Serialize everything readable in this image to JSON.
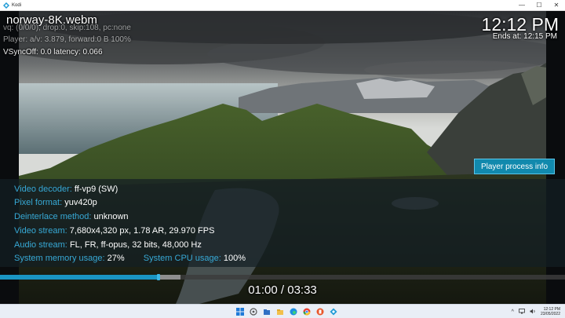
{
  "window": {
    "app_title": "Kodi",
    "controls": {
      "minimize": "—",
      "maximize": "☐",
      "close": "✕"
    }
  },
  "osd": {
    "file_title": "norway-8K.webm",
    "debug_line1": "vq:                               (0/0/0), drop:0, skip:108, pc:none",
    "debug_line2": "Player: a/v: 3.879, forward:0 B 100%",
    "debug_line3": "VSyncOff: 0.0 latency: 0.066",
    "clock": "12:12 PM",
    "ends_at": "Ends at: 12:15 PM",
    "player_process_info_button": "Player process info",
    "info": {
      "video_decoder": {
        "key": "Video decoder:",
        "value": "ff-vp9 (SW)"
      },
      "pixel_format": {
        "key": "Pixel format:",
        "value": "yuv420p"
      },
      "deinterlace": {
        "key": "Deinterlace method:",
        "value": "unknown"
      },
      "video_stream": {
        "key": "Video stream:",
        "value": "7,680x4,320 px, 1.78 AR, 29.970 FPS"
      },
      "audio_stream": {
        "key": "Audio stream:",
        "value": "FL, FR, ff-opus, 32 bits, 48,000 Hz"
      },
      "sys_memory": {
        "key": "System memory usage:",
        "value": "27%"
      },
      "sys_cpu": {
        "key": "System CPU usage:",
        "value": "100%"
      }
    },
    "elapsed_time": "01:00 / 03:33",
    "progress_fraction": 0.281,
    "cache_fraction": 0.32
  },
  "taskbar": {
    "icons": [
      "windows-start-icon",
      "widgets-icon",
      "file-explorer-icon",
      "folder-icon",
      "edge-browser-icon",
      "chrome-icon",
      "app-icon",
      "kodi-icon"
    ],
    "tray_time": "12:12 PM",
    "tray_date": "23/05/2022"
  },
  "colors": {
    "accent": "#1a95c3",
    "label_blue": "#37a9d6",
    "button_bg": "#1189ad"
  }
}
